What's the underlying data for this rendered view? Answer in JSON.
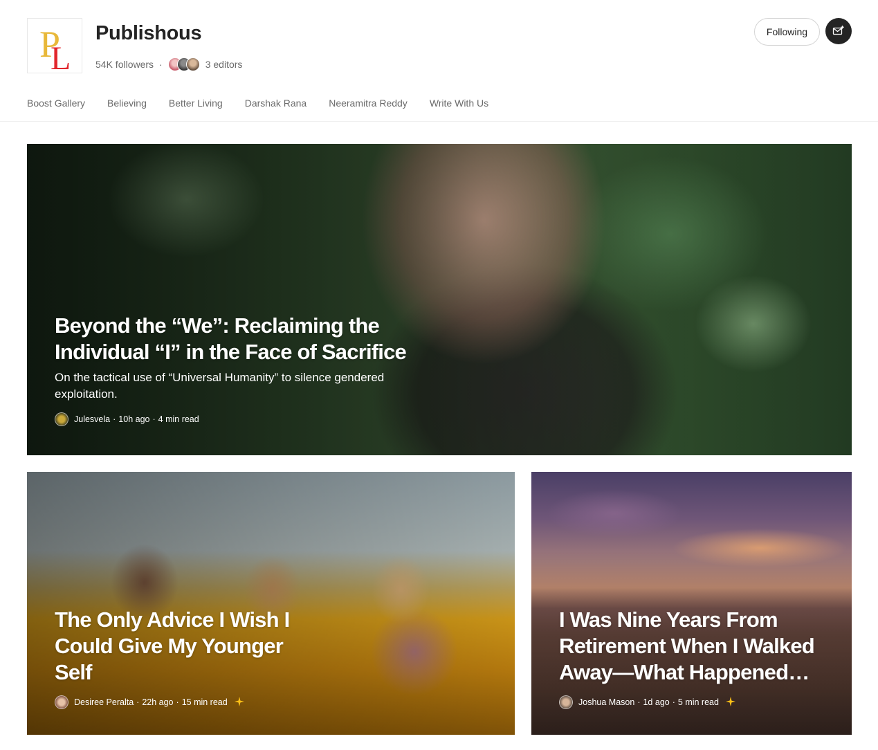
{
  "publication": {
    "name": "Publishous",
    "followers": "54K followers",
    "editors": "3 editors",
    "logo_letters": "PL"
  },
  "actions": {
    "follow_label": "Following",
    "subscribe_icon": "mail-plus-icon"
  },
  "nav": {
    "items": [
      "Boost Gallery",
      "Believing",
      "Better Living",
      "Darshak Rana",
      "Neeramitra Reddy",
      "Write With Us"
    ]
  },
  "stories": {
    "hero": {
      "title": "Beyond the “We”: Reclaiming the Individual “I” in the Face of Sacrifice",
      "subtitle": "On the tactical use of “Universal Humanity” to silence gendered exploitation.",
      "author": "Julesvela",
      "time": "10h ago",
      "read": "4 min read"
    },
    "second": {
      "title": "The Only Advice I Wish I Could Give My Younger Self",
      "author": "Desiree Peralta",
      "time": "22h ago",
      "read": "15 min read",
      "member_only": true
    },
    "third": {
      "title": "I Was Nine Years From Retirement When I Walked Away—What Happened…",
      "author": "Joshua Mason",
      "time": "1d ago",
      "read": "5 min read",
      "member_only": true
    }
  },
  "colors": {
    "text": "#242424",
    "muted": "#6b6b6b",
    "logo_gold": "#e8b83a",
    "logo_red": "#e1262c",
    "sparkle": "#ffc017"
  }
}
